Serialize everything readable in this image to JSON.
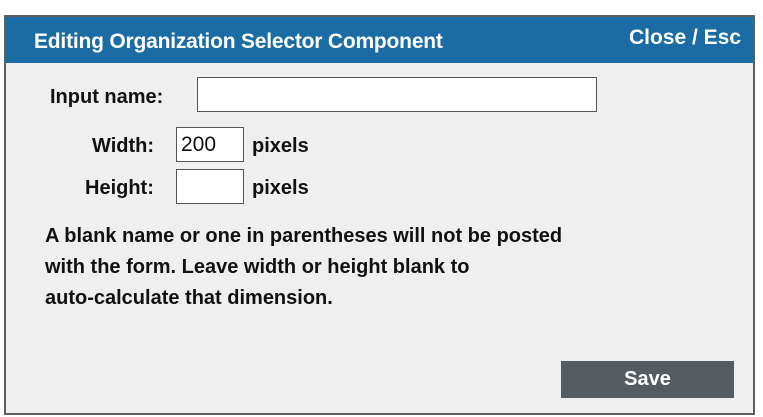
{
  "dialog": {
    "title": "Editing Organization Selector Component",
    "close_label": "Close / Esc"
  },
  "form": {
    "input_name": {
      "label": "Input name:",
      "value": ""
    },
    "width": {
      "label": "Width:",
      "value": "200",
      "unit": "pixels"
    },
    "height": {
      "label": "Height:",
      "value": "",
      "unit": "pixels"
    },
    "help_lines": [
      "A blank name or one in parentheses will not be posted",
      "with the form. Leave width or height blank to",
      "auto-calculate that dimension."
    ]
  },
  "actions": {
    "save_label": "Save"
  }
}
